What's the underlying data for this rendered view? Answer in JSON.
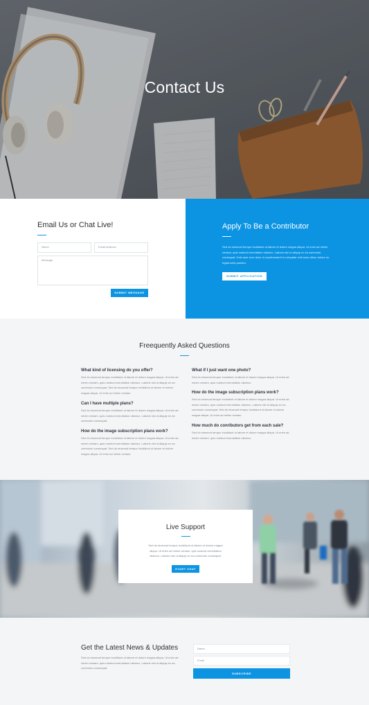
{
  "hero": {
    "title": "Contact Us"
  },
  "contact": {
    "title": "Email Us or Chat Live!",
    "name_placeholder": "Name",
    "email_placeholder": "Email Address",
    "message_placeholder": "Message",
    "submit_label": "SUBMIT MESSAGE"
  },
  "contributor": {
    "title": "Apply To Be a Contributor",
    "text": "Sed do eiusmod tempor incididunt ut labore et dolore magna aliqua. Ut enim ad minim veniam, quis nostrud exercitation ullamco. Laboris nisi ut aliquip ex ea commodo consequat. Duis aute irure dolor in reprehenderit in voluptate velit esse cillum dolore eu fugiat nulla pariatur.",
    "button_label": "SUBMIT APPLICATION"
  },
  "faq": {
    "title": "Freequently Asked Questions",
    "left": [
      {
        "q": "What kind of licensing do you offer?",
        "a": "Sed do eiusmod tempor incididunt ut labore et dolore magna aliqua. Ut enim ad minim veniam, quis nostrud exercitation ullamco. Laboris nisi ut aliquip ex ea commodo consequat. Sed do eiusmod tempor incididunt ut labore et dolore magna aliqua. Ut enim ad minim veniam."
      },
      {
        "q": "Can I have multiple plans?",
        "a": "Sed do eiusmod tempor incididunt ut labore et dolore magna aliqua. Ut enim ad minim veniam, quis nostrud exercitation ullamco. Laboris nisi ut aliquip ex ea commodo consequat."
      },
      {
        "q": "How do the image subscription plans work?",
        "a": "Sed do eiusmod tempor incididunt ut labore et dolore magna aliqua. Ut enim ad minim veniam, quis nostrud exercitation ullamco. Laboris nisi ut aliquip ex ea commodo consequat. Sed do eiusmod tempor incididunt ut labore et dolore magna aliqua. Ut enim ad minim veniam."
      }
    ],
    "right": [
      {
        "q": "What if I just want one photo?",
        "a": "Sed do eiusmod tempor incididunt ut labore et dolore magna aliqua. Ut enim ad minim veniam, quis nostrud exercitation ullamco."
      },
      {
        "q": "How do the image subscription plans work?",
        "a": "Sed do eiusmod tempor incididunt ut labore et dolore magna aliqua. Ut enim ad minim veniam, quis nostrud exercitation ullamco. Laboris nisi ut aliquip ex ea commodo consequat. Sed do eiusmod tempor incididunt ut labore et dolore magna aliqua. Ut enim ad minim veniam."
      },
      {
        "q": "How much do conributors get from each sale?",
        "a": "Sed do eiusmod tempor incididunt ut labore et dolore magna aliqua. Ut enim ad minim veniam, quis nostrud exercitation ullamco."
      }
    ]
  },
  "live": {
    "title": "Live Support",
    "text": "Sed do eiusmod tempor incididunt ut labore et dolore magna aliqua. Ut enim ad minim veniam, quis nostrud exercitation ullamco. Laboris nisi ut aliquip ex ea commodo consequat.",
    "button_label": "START CHAT"
  },
  "newsletter": {
    "title": "Get the Latest News & Updates",
    "text": "Sed do eiusmod tempor incididunt ut labore et dolore magna aliqua. Ut enim ad minim veniam, quis nostrud exercitation ullamco. Laboris nisi ut aliquip ex ea commodo consequat.",
    "name_placeholder": "Name",
    "email_placeholder": "Email",
    "button_label": "SUBSCRIBE"
  },
  "colors": {
    "accent": "#0c94e3",
    "background": "#f4f5f6",
    "heading": "#2b3035"
  }
}
